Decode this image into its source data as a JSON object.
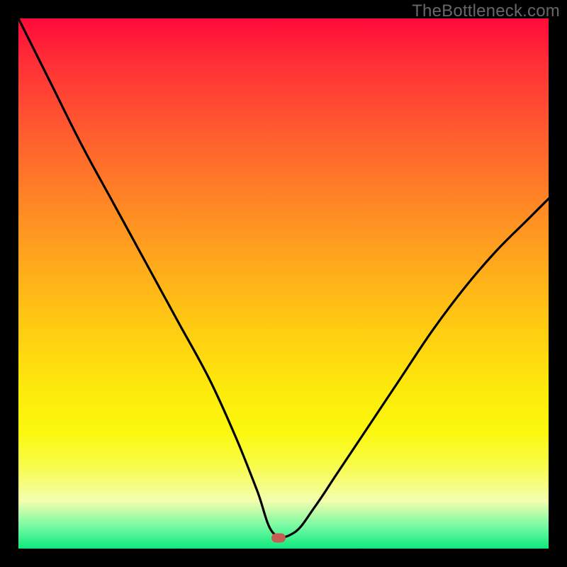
{
  "watermark": "TheBottleneck.com",
  "colors": {
    "frame": "#000000",
    "gradient_top": "#ff0a3b",
    "gradient_bottom": "#0cea7e",
    "curve": "#000000",
    "marker": "#c85b52",
    "watermark": "#676767"
  },
  "chart_data": {
    "type": "line",
    "title": "",
    "xlabel": "",
    "ylabel": "",
    "xlim": [
      0,
      100
    ],
    "ylim": [
      0,
      100
    ],
    "marker": {
      "x": 49,
      "y": 2
    },
    "series": [
      {
        "name": "curve",
        "x": [
          0,
          6,
          12,
          18,
          24,
          30,
          36,
          41,
          45,
          48,
          52,
          56,
          60,
          66,
          72,
          78,
          84,
          90,
          96,
          100
        ],
        "y": [
          100,
          88,
          76,
          65,
          54,
          43,
          32,
          21,
          11,
          3,
          3,
          8,
          14,
          23,
          32,
          41,
          49,
          56,
          62,
          66
        ]
      }
    ]
  }
}
